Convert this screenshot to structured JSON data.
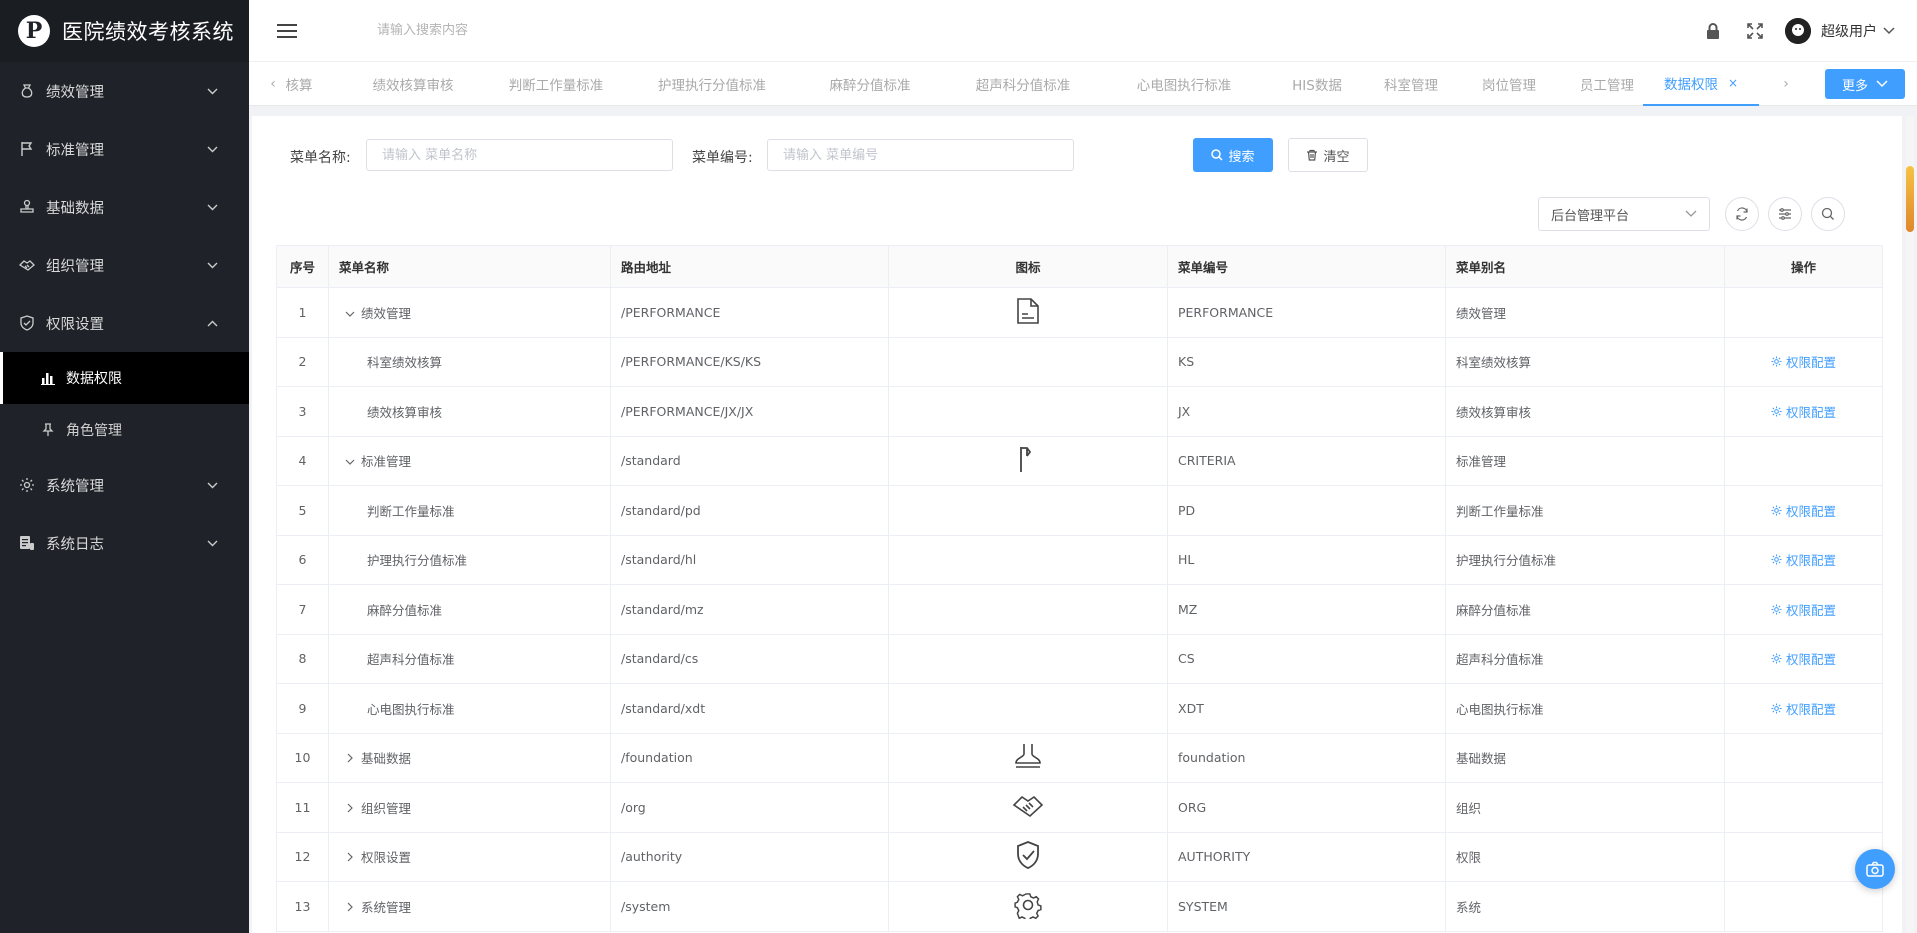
{
  "app": {
    "title": "医院绩效考核系统"
  },
  "sidebar": {
    "items": [
      {
        "label": "绩效管理",
        "icon": "money-bag-icon",
        "expanded": false
      },
      {
        "label": "标准管理",
        "icon": "flag-icon",
        "expanded": false
      },
      {
        "label": "基础数据",
        "icon": "stamp-icon",
        "expanded": false
      },
      {
        "label": "组织管理",
        "icon": "handshake-icon",
        "expanded": false
      },
      {
        "label": "权限设置",
        "icon": "shield-check-icon",
        "expanded": true,
        "children": [
          {
            "label": "数据权限",
            "icon": "bar-chart-icon",
            "active": true
          },
          {
            "label": "角色管理",
            "icon": "pin-icon",
            "active": false
          }
        ]
      },
      {
        "label": "系统管理",
        "icon": "gear-icon",
        "expanded": false
      },
      {
        "label": "系统日志",
        "icon": "log-icon",
        "expanded": false
      }
    ]
  },
  "header": {
    "search_placeholder": "请输入搜索内容",
    "username": "超级用户"
  },
  "tabs": {
    "items": [
      "核算",
      "绩效核算审核",
      "判断工作量标准",
      "护理执行分值标准",
      "麻醉分值标准",
      "超声科分值标准",
      "心电图执行标准",
      "HIS数据",
      "科室管理",
      "岗位管理",
      "员工管理",
      "数据权限"
    ],
    "active_index": 11,
    "more_label": "更多"
  },
  "filters": {
    "menu_name_label": "菜单名称:",
    "menu_name_placeholder": "请输入 菜单名称",
    "menu_code_label": "菜单编号:",
    "menu_code_placeholder": "请输入 菜单编号",
    "search_button": "搜索",
    "clear_button": "清空",
    "platform_selected": "后台管理平台"
  },
  "table": {
    "columns": [
      "序号",
      "菜单名称",
      "路由地址",
      "图标",
      "菜单编号",
      "菜单别名",
      "操作"
    ],
    "rows": [
      {
        "idx": "1",
        "name": "绩效管理",
        "route": "/PERFORMANCE",
        "icon": "document-icon",
        "code": "PERFORMANCE",
        "alias": "绩效管理",
        "op": "",
        "tree": "expanded",
        "child": false
      },
      {
        "idx": "2",
        "name": "科室绩效核算",
        "route": "/PERFORMANCE/KS/KS",
        "icon": "",
        "code": "KS",
        "alias": "科室绩效核算",
        "op": "权限配置",
        "tree": "",
        "child": true
      },
      {
        "idx": "3",
        "name": "绩效核算审核",
        "route": "/PERFORMANCE/JX/JX",
        "icon": "",
        "code": "JX",
        "alias": "绩效核算审核",
        "op": "权限配置",
        "tree": "",
        "child": true
      },
      {
        "idx": "4",
        "name": "标准管理",
        "route": "/standard",
        "icon": "flag-icon",
        "code": "CRITERIA",
        "alias": "标准管理",
        "op": "",
        "tree": "expanded",
        "child": false
      },
      {
        "idx": "5",
        "name": "判断工作量标准",
        "route": "/standard/pd",
        "icon": "",
        "code": "PD",
        "alias": "判断工作量标准",
        "op": "权限配置",
        "tree": "",
        "child": true
      },
      {
        "idx": "6",
        "name": "护理执行分值标准",
        "route": "/standard/hl",
        "icon": "",
        "code": "HL",
        "alias": "护理执行分值标准",
        "op": "权限配置",
        "tree": "",
        "child": true
      },
      {
        "idx": "7",
        "name": "麻醉分值标准",
        "route": "/standard/mz",
        "icon": "",
        "code": "MZ",
        "alias": "麻醉分值标准",
        "op": "权限配置",
        "tree": "",
        "child": true
      },
      {
        "idx": "8",
        "name": "超声科分值标准",
        "route": "/standard/cs",
        "icon": "",
        "code": "CS",
        "alias": "超声科分值标准",
        "op": "权限配置",
        "tree": "",
        "child": true
      },
      {
        "idx": "9",
        "name": "心电图执行标准",
        "route": "/standard/xdt",
        "icon": "",
        "code": "XDT",
        "alias": "心电图执行标准",
        "op": "权限配置",
        "tree": "",
        "child": true
      },
      {
        "idx": "10",
        "name": "基础数据",
        "route": "/foundation",
        "icon": "stamp-icon",
        "code": "foundation",
        "alias": "基础数据",
        "op": "",
        "tree": "collapsed",
        "child": false
      },
      {
        "idx": "11",
        "name": "组织管理",
        "route": "/org",
        "icon": "handshake-icon",
        "code": "ORG",
        "alias": "组织",
        "op": "",
        "tree": "collapsed",
        "child": false
      },
      {
        "idx": "12",
        "name": "权限设置",
        "route": "/authority",
        "icon": "shield-check-icon",
        "code": "AUTHORITY",
        "alias": "权限",
        "op": "",
        "tree": "collapsed",
        "child": false
      },
      {
        "idx": "13",
        "name": "系统管理",
        "route": "/system",
        "icon": "gear-icon",
        "code": "SYSTEM",
        "alias": "系统",
        "op": "",
        "tree": "collapsed",
        "child": false
      }
    ]
  },
  "colors": {
    "sidebar_bg": "#1f2329",
    "primary": "#409eff",
    "active_bg": "#000000"
  }
}
